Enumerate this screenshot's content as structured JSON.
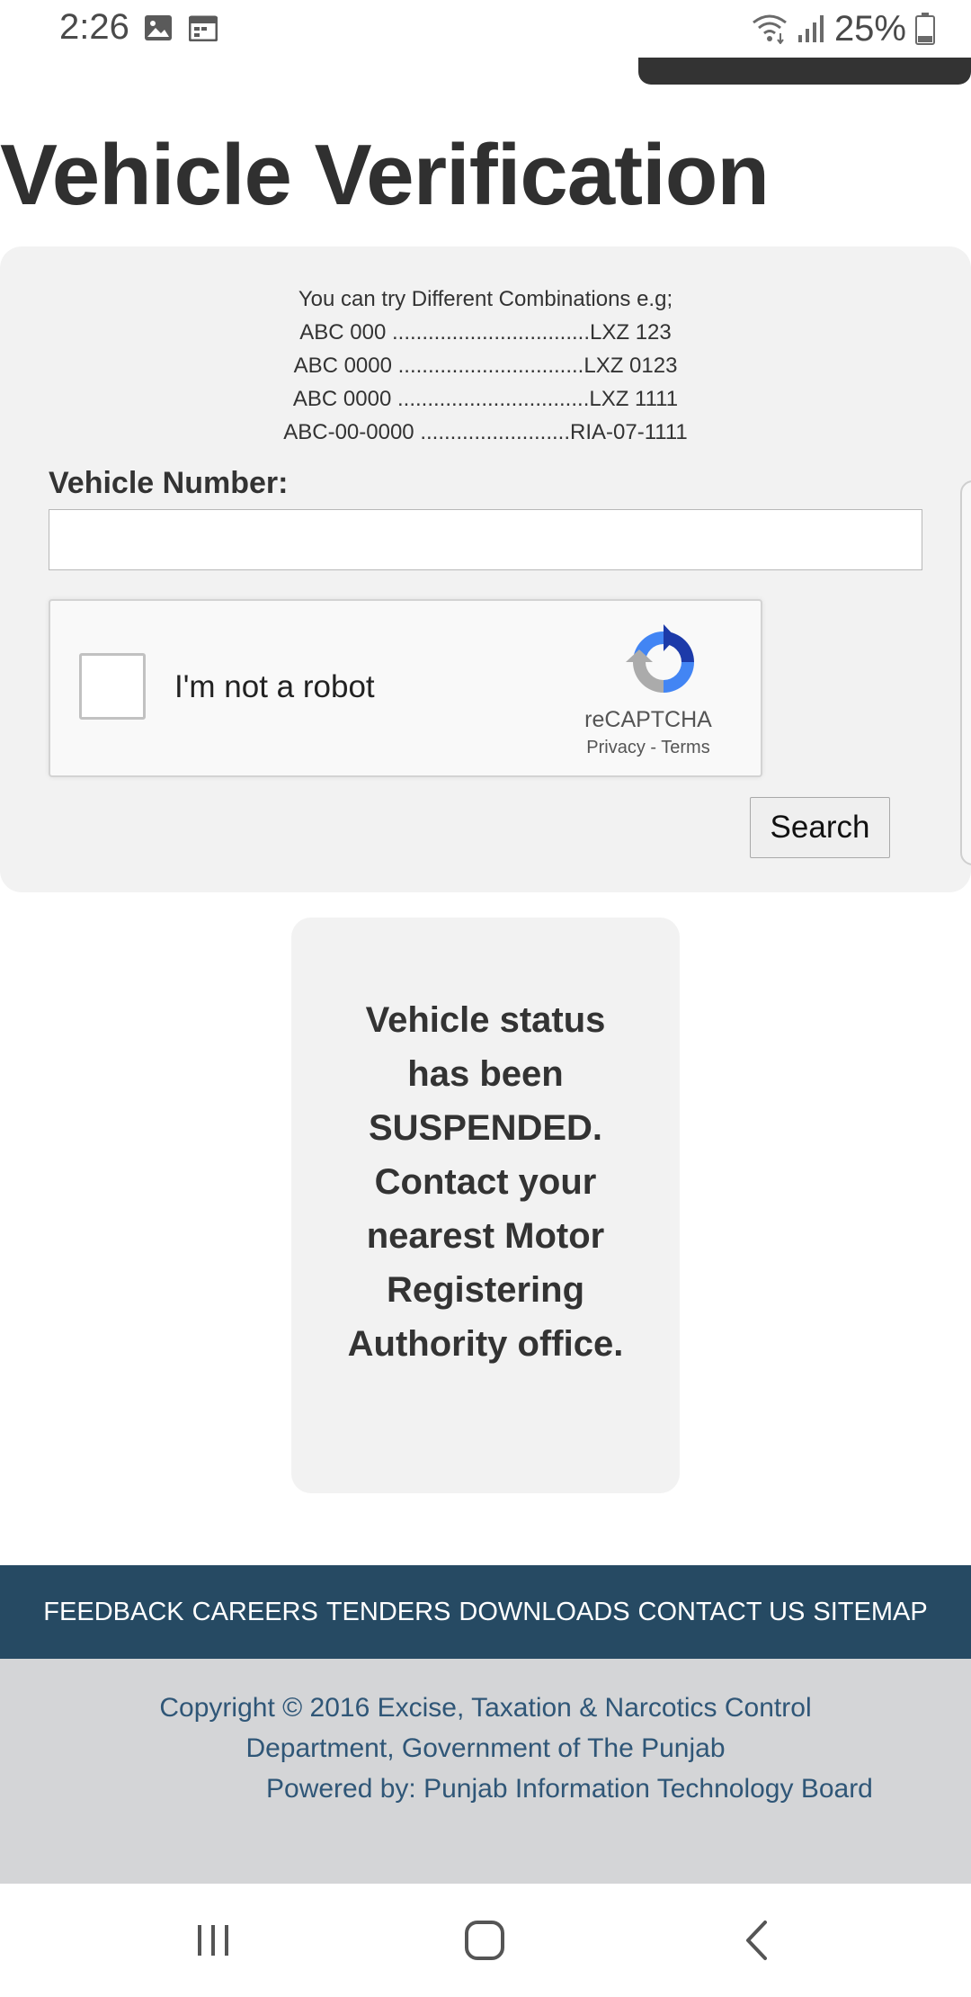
{
  "status_bar": {
    "time": "2:26",
    "battery": "25%",
    "icons": [
      "image-icon",
      "calendar-icon",
      "wifi-icon",
      "signal-icon",
      "battery-icon"
    ]
  },
  "page": {
    "title": "Vehicle Verification"
  },
  "form": {
    "intro": "You can try Different Combinations e.g;",
    "combinations": [
      "ABC 000 .................................LXZ 123",
      "ABC 0000 ...............................LXZ 0123",
      "ABC 0000 ................................LXZ 1111",
      "ABC-00-0000 .........................RIA-07-1111"
    ],
    "vehicle_label": "Vehicle Number:",
    "vehicle_value": "",
    "recaptcha": {
      "label": "I'm not a robot",
      "brand": "reCAPTCHA",
      "privacy": "Privacy",
      "separator": " - ",
      "terms": "Terms"
    },
    "search_label": "Search"
  },
  "result": {
    "message": "Vehicle status has been SUSPENDED. Contact your nearest Motor Registering Authority office."
  },
  "footer": {
    "links": [
      "FEEDBACK",
      "CAREERS",
      "TENDERS",
      "DOWNLOADS",
      "CONTACT US",
      "SITEMAP"
    ],
    "copyright_line1": "Copyright © 2016 Excise, Taxation & Narcotics Control",
    "copyright_line2": "Department, Government of The Punjab",
    "powered_by": "Powered by: Punjab Information Technology Board"
  },
  "colors": {
    "footer_nav_bg": "#264a63",
    "footer_info_bg": "#d4d5d7",
    "footer_info_text": "#2f5677",
    "panel_bg": "#f2f2f2"
  }
}
